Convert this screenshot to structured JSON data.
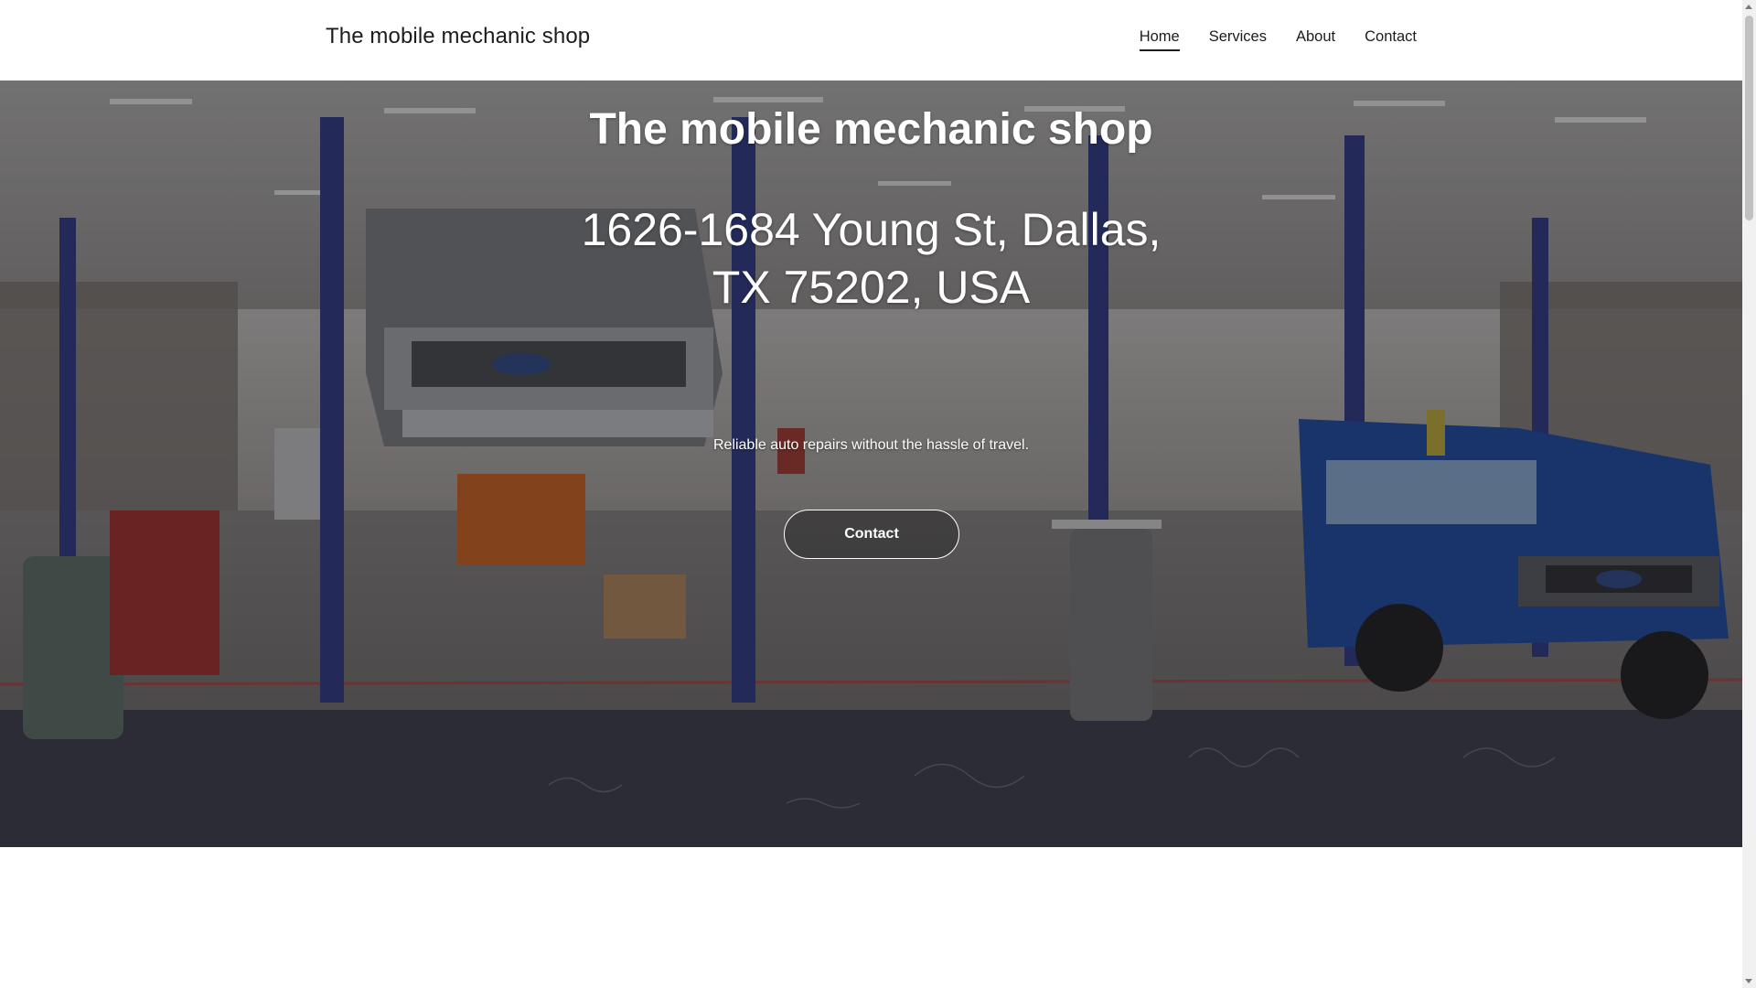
{
  "header": {
    "brand": "The mobile mechanic shop",
    "nav": [
      {
        "label": "Home",
        "active": true
      },
      {
        "label": "Services",
        "active": false
      },
      {
        "label": "About",
        "active": false
      },
      {
        "label": "Contact",
        "active": false
      }
    ]
  },
  "hero": {
    "title": "The mobile mechanic shop",
    "address": "1626-1684 Young St, Dallas, TX 75202, USA",
    "tagline": "Reliable auto repairs without the hassle of travel.",
    "button_label": "Contact",
    "background": "auto-repair-garage-photo"
  },
  "colors": {
    "header_bg": "#ffffff",
    "text_dark": "#1c1c1c",
    "hero_text": "#ffffff",
    "scrollbar_track": "#f1f1f1",
    "scrollbar_thumb": "#c1c1c1"
  }
}
